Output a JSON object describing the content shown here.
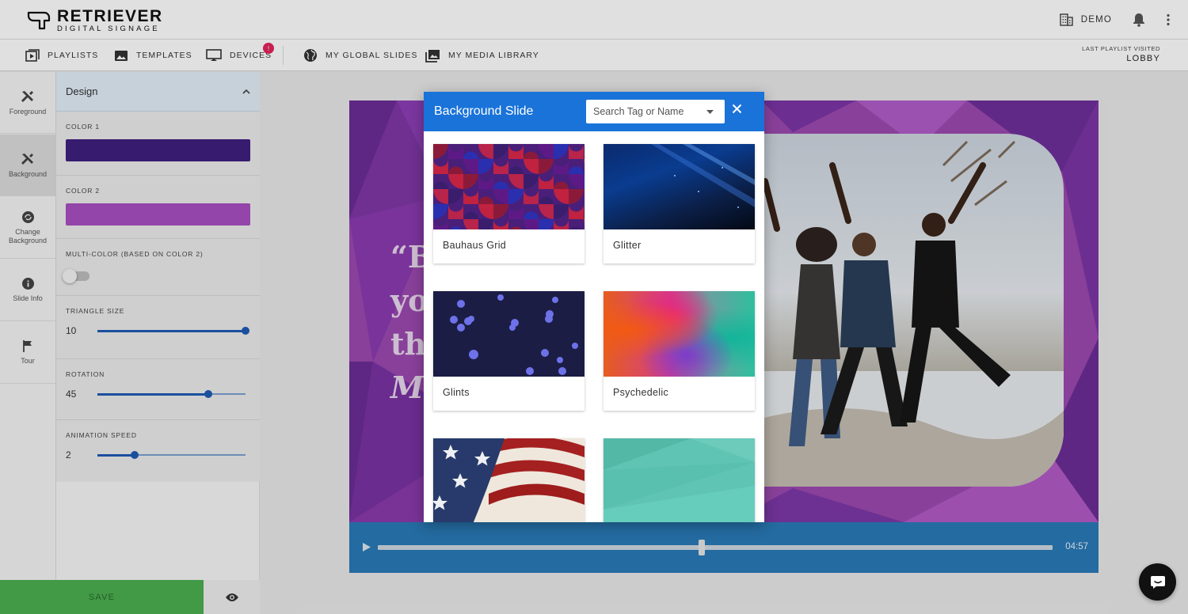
{
  "header": {
    "logo_title": "RETRIEVER",
    "logo_subtitle": "DIGITAL SIGNAGE",
    "account": "DEMO"
  },
  "nav": {
    "items": [
      {
        "label": "PLAYLISTS",
        "icon": "playlist-play-icon"
      },
      {
        "label": "TEMPLATES",
        "icon": "image-icon"
      },
      {
        "label": "DEVICES",
        "icon": "monitor-icon"
      },
      {
        "label": "MY GLOBAL SLIDES",
        "icon": "globe-icon"
      },
      {
        "label": "MY MEDIA LIBRARY",
        "icon": "photo-library-icon"
      }
    ],
    "devices_badge": "!",
    "last_visited_label": "LAST PLAYLIST VISITED",
    "last_visited_value": "LOBBY"
  },
  "rail": {
    "items": [
      {
        "label": "Foreground",
        "icon": "tools-icon"
      },
      {
        "label": "Background",
        "icon": "tools-icon"
      },
      {
        "label": "Change Background",
        "icon": "change-icon"
      },
      {
        "label": "Slide Info",
        "icon": "info-icon"
      },
      {
        "label": "Tour",
        "icon": "flag-icon"
      }
    ],
    "active": "Background"
  },
  "panel": {
    "title": "Design",
    "color1_label": "COLOR 1",
    "color1": "#3f1f7f",
    "color2_label": "COLOR 2",
    "color2": "#a94fc1",
    "multicolor_label": "MULTI-COLOR (BASED ON COLOR 2)",
    "multicolor_on": false,
    "triangle_label": "TRIANGLE SIZE",
    "triangle_value": "10",
    "triangle_level": 1.0,
    "rotation_label": "ROTATION",
    "rotation_value": "45",
    "rotation_level": 0.75,
    "speed_label": "ANIMATION SPEED",
    "speed_value": "2",
    "speed_level": 0.25,
    "save_label": "SAVE"
  },
  "preview": {
    "quote_lines": [
      "“B",
      "yo",
      "th",
      "M"
    ],
    "time": "04:57",
    "progress": 0.48
  },
  "modal": {
    "title": "Background Slide",
    "search_placeholder": "Search Tag or Name",
    "cards": [
      {
        "label": "Bauhaus Grid"
      },
      {
        "label": "Glitter"
      },
      {
        "label": "Glints"
      },
      {
        "label": "Psychedelic"
      },
      {
        "label": ""
      },
      {
        "label": ""
      }
    ]
  },
  "colors": {
    "accent": "#1a73d9",
    "save": "#4caf50",
    "badge": "#e3245b",
    "slide_bg": "#9d49b0"
  }
}
